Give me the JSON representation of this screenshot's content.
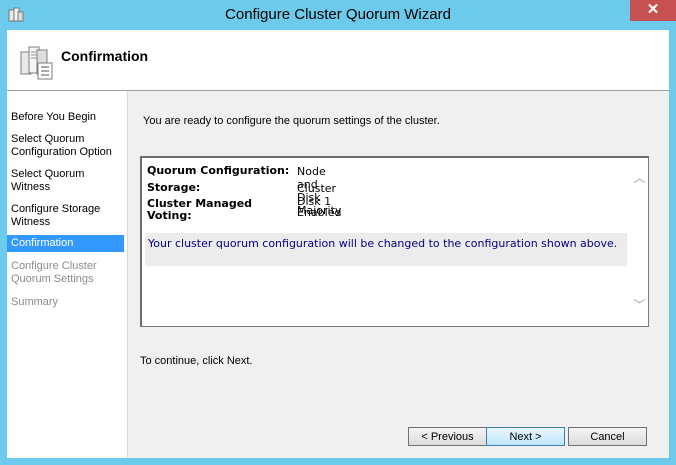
{
  "window": {
    "title": "Configure Cluster Quorum Wizard",
    "close_glyph": "✕"
  },
  "header": {
    "title": "Confirmation"
  },
  "nav": {
    "items": [
      {
        "label": "Before You Begin",
        "state": "normal"
      },
      {
        "label": "Select Quorum Configuration Option",
        "state": "normal"
      },
      {
        "label": "Select Quorum Witness",
        "state": "normal"
      },
      {
        "label": "Configure Storage Witness",
        "state": "normal"
      },
      {
        "label": "Confirmation",
        "state": "active"
      },
      {
        "label": "Configure Cluster Quorum Settings",
        "state": "disabled"
      },
      {
        "label": "Summary",
        "state": "disabled"
      }
    ]
  },
  "main": {
    "intro": "You are ready to configure the quorum settings of the cluster.",
    "details": [
      {
        "label": "Quorum Configuration:",
        "value": "Node and Disk Majority"
      },
      {
        "label": "Storage:",
        "value": "Cluster Disk 1"
      },
      {
        "label": "Cluster Managed Voting:",
        "value": "Enabled"
      }
    ],
    "notice": "Your cluster quorum configuration will be changed to the configuration shown above.",
    "continue_text": "To continue, click Next."
  },
  "buttons": {
    "previous": "< Previous",
    "next": "Next >",
    "cancel": "Cancel"
  },
  "colors": {
    "title_bar": "#6ccbea",
    "close": "#c75050",
    "selection": "#3399ff",
    "notice_text": "#000080"
  }
}
